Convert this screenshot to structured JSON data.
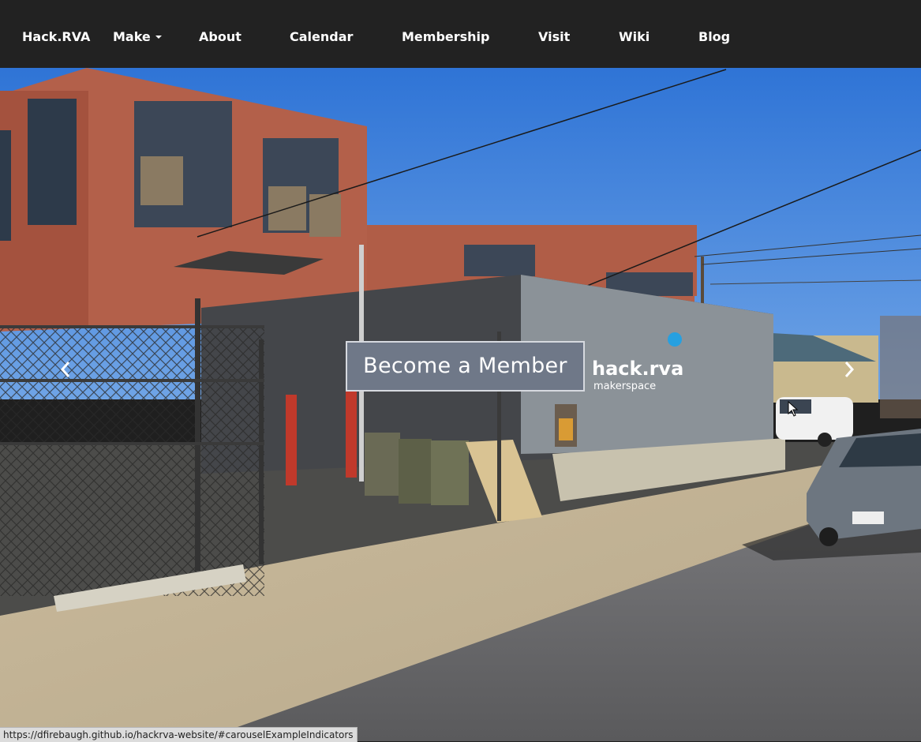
{
  "navbar": {
    "brand": "Hack.RVA",
    "items": [
      "Make",
      "About",
      "Calendar",
      "Membership",
      "Visit",
      "Wiki",
      "Blog"
    ]
  },
  "hero": {
    "cta_label": "Become a Member",
    "logo_text": "hack.rva",
    "logo_subtext": "makerspace"
  },
  "status_bar": {
    "url": "https://dfirebaugh.github.io/hackrva-website/#carouselExampleIndicators"
  },
  "icons": {
    "prev": "chevron-left-icon",
    "next": "chevron-right-icon",
    "dropdown": "caret-down-icon",
    "cursor": "mouse-pointer-icon"
  },
  "colors": {
    "navbar_bg": "#222222",
    "cta_bg": "#6f7888",
    "sky": "#3f83dd",
    "brick": "#b86048"
  }
}
